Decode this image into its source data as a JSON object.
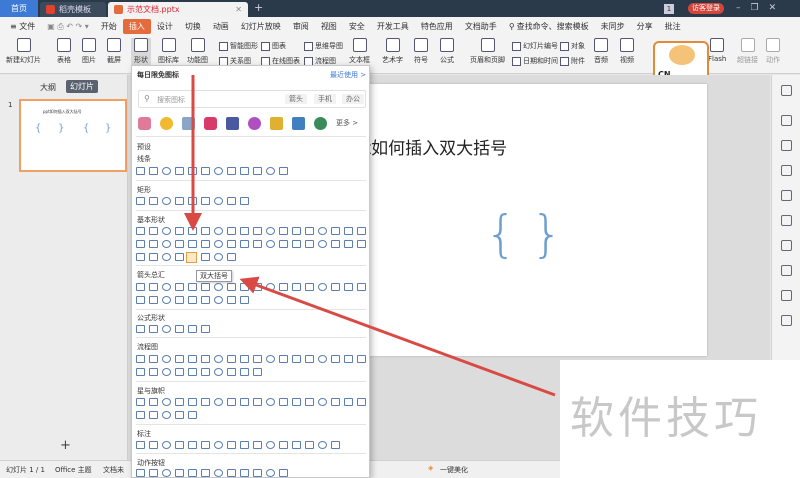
{
  "titlebar": {
    "home_tab": "首页",
    "tab1": "稻壳模板",
    "tab2": "示范文档.pptx",
    "add_tab": "+",
    "page_num": "1",
    "login": "访客登录"
  },
  "menu": {
    "file": "≡ 文件",
    "items": [
      "开始",
      "插入",
      "设计",
      "切换",
      "动画",
      "幻灯片放映",
      "审阅",
      "视图",
      "安全",
      "开发工具",
      "特色应用",
      "文档助手"
    ],
    "search": "查找命令、搜索模板",
    "sync": "未同步",
    "share": "分享",
    "comment": "批注"
  },
  "toolbar": {
    "new_slide": "新建幻灯片",
    "table": "表格",
    "image": "图片",
    "screenshot": "截屏",
    "shape": "形状",
    "gallery": "图标库",
    "func_chart": "功能图",
    "smart_art": "智能图形",
    "chart": "图表",
    "mind_map": "思维导图",
    "relation": "关系图",
    "online_chart": "在线图表",
    "flow": "流程图",
    "textbox": "文本框",
    "art_text": "艺术字",
    "symbol": "符号",
    "formula": "公式",
    "header_footer": "页眉和页脚",
    "slide_number": "幻灯片编号",
    "object": "对象",
    "date_time": "日期和时间",
    "attachment": "附件",
    "audio": "音频",
    "video": "视频",
    "flash": "Flash",
    "hyperlink": "超链接",
    "action": "动作"
  },
  "leftpanel": {
    "tab_outline": "大纲",
    "tab_slides": "幻灯片",
    "slide_number": "1",
    "add": "+",
    "thumb_title": "ppt如何插入双大括号"
  },
  "slide": {
    "title": "ppt如何插入双大括号",
    "brace_left": "{",
    "brace_right": "}"
  },
  "dropdown": {
    "frequent_title": "每日限免图标",
    "recent": "最近使用",
    "search_placeholder": "搜索图标",
    "cat1": "箭头",
    "cat2": "手机",
    "cat3": "办公",
    "more": "更多",
    "preset": "预设",
    "lines": "线条",
    "rect": "矩形",
    "basic": "基本形状",
    "arrows": "箭头总汇",
    "formula": "公式形状",
    "flowchart": "流程图",
    "stars": "星与旗帜",
    "callout": "标注",
    "action": "动作按钮"
  },
  "tooltip": "双大括号",
  "statusbar": {
    "slide_info": "幻灯片 1 / 1",
    "theme": "Office 主题",
    "doc": "文档未",
    "beautify": "一键美化"
  },
  "watermark": "软件技巧",
  "mascot": {
    "text": "CN"
  },
  "colors": {
    "accent": "#e36b3c",
    "arrow": "#d94a45",
    "shape_stroke": "#5a7fb0",
    "brace": "#6e9ecf"
  }
}
